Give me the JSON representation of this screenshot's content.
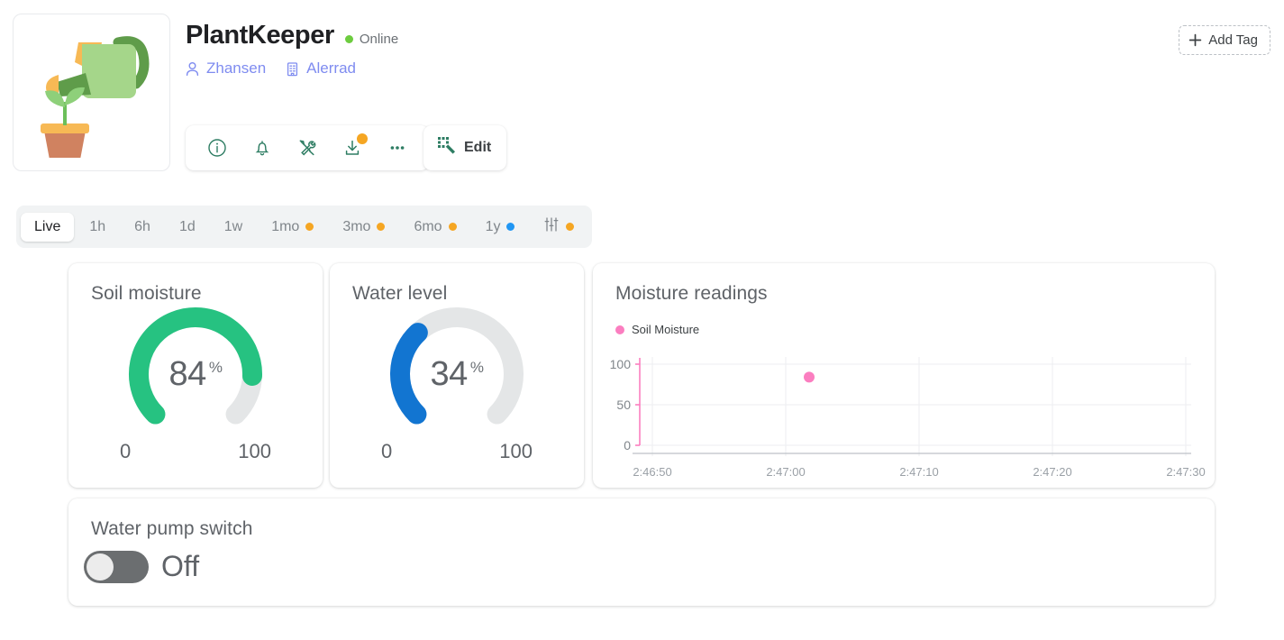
{
  "header": {
    "title": "PlantKeeper",
    "status": "Online",
    "status_color": "#6dcc3f",
    "owner": "Zhansen",
    "owner_icon": "user-icon",
    "organization": "Alerrad",
    "organization_icon": "building-icon",
    "add_tag_label": "Add Tag",
    "add_tag_icon": "plus-icon",
    "avatar_icon": "watering-can-plant-illustration"
  },
  "toolbar": {
    "buttons": [
      {
        "name": "info-button",
        "icon": "info-circle-icon",
        "badge": false
      },
      {
        "name": "alerts-button",
        "icon": "bell-icon",
        "badge": false
      },
      {
        "name": "tools-button",
        "icon": "tools-icon",
        "badge": false
      },
      {
        "name": "download-button",
        "icon": "download-icon",
        "badge": true
      },
      {
        "name": "more-button",
        "icon": "more-horizontal-icon",
        "badge": false
      }
    ],
    "badge_color": "#f5a623",
    "edit_label": "Edit",
    "edit_icon": "qr-edit-icon",
    "icon_color": "#2e7d63"
  },
  "tabs": {
    "items": [
      {
        "label": "Live",
        "active": true,
        "dot": null
      },
      {
        "label": "1h",
        "active": false,
        "dot": null
      },
      {
        "label": "6h",
        "active": false,
        "dot": null
      },
      {
        "label": "1d",
        "active": false,
        "dot": null
      },
      {
        "label": "1w",
        "active": false,
        "dot": null
      },
      {
        "label": "1mo",
        "active": false,
        "dot": "#f5a623"
      },
      {
        "label": "3mo",
        "active": false,
        "dot": "#f5a623"
      },
      {
        "label": "6mo",
        "active": false,
        "dot": "#f5a623"
      },
      {
        "label": "1y",
        "active": false,
        "dot": "#2196f3"
      },
      {
        "label": "",
        "active": false,
        "dot": "#f5a623",
        "icon": "sliders-icon"
      }
    ]
  },
  "cards": {
    "soil": {
      "title": "Soil moisture",
      "value": "84",
      "unit": "%",
      "min": "0",
      "max": "100",
      "color": "#26c281",
      "track_color": "#e4e6e7"
    },
    "water": {
      "title": "Water level",
      "value": "34",
      "unit": "%",
      "min": "0",
      "max": "100",
      "color": "#1275d1",
      "track_color": "#e4e6e7"
    },
    "chart": {
      "title": "Moisture readings"
    },
    "pump": {
      "title": "Water pump switch",
      "state_label": "Off",
      "on": false
    }
  },
  "chart_data": {
    "type": "scatter",
    "title": "Moisture readings",
    "legend": [
      {
        "name": "Soil Moisture",
        "color": "#fb7ec0"
      }
    ],
    "legend_position": "top-left",
    "xlabel": "",
    "ylabel": "",
    "ylim": [
      0,
      100
    ],
    "yticks": [
      "0",
      "50",
      "100"
    ],
    "xticks": [
      "2:46:50",
      "2:47:00",
      "2:47:10",
      "2:47:20",
      "2:47:30"
    ],
    "grid": "vertical",
    "axis_color": "#fb7ec0",
    "series": [
      {
        "name": "Soil Moisture",
        "color": "#fb7ec0",
        "points": [
          {
            "x": "2:47:02",
            "y": 84
          }
        ]
      }
    ]
  }
}
